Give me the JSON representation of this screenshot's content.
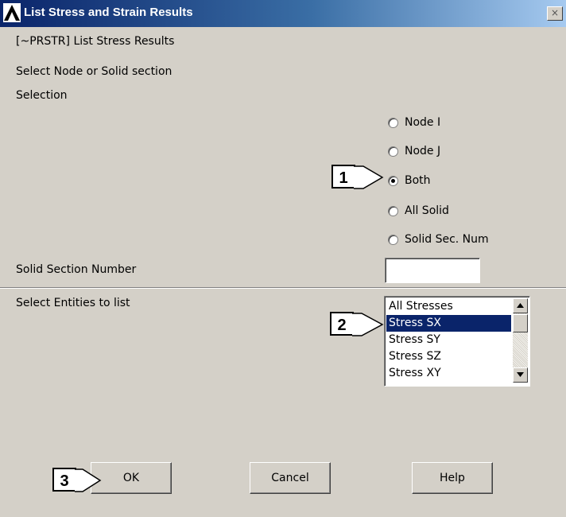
{
  "window": {
    "title": "List Stress and Strain Results",
    "close_glyph": "×",
    "logo_icon": "ansys-logo-icon"
  },
  "form": {
    "command_line": "[~PRSTR] List Stress Results",
    "select_prompt": "Select Node or Solid section",
    "selection_label": "Selection",
    "radio_options": [
      {
        "label": "Node I",
        "checked": false
      },
      {
        "label": "Node J",
        "checked": false
      },
      {
        "label": "Both",
        "checked": true
      },
      {
        "label": "All Solid",
        "checked": false
      },
      {
        "label": "Solid Sec. Num",
        "checked": false
      }
    ],
    "solid_section_label": "Solid Section Number",
    "solid_section_value": "",
    "entities_label": "Select Entities to list",
    "entities": [
      "All Stresses",
      "Stress SX",
      "Stress SY",
      "Stress SZ",
      "Stress XY"
    ],
    "selected_entity": "Stress SX"
  },
  "buttons": {
    "ok": "OK",
    "cancel": "Cancel",
    "help": "Help"
  },
  "callouts": [
    "1",
    "2",
    "3"
  ],
  "colors": {
    "dialog_bg": "#d4d0c8",
    "selection_bg": "#0a246a",
    "title_gradient_start": "#0a246a",
    "title_gradient_end": "#a6caf0"
  }
}
